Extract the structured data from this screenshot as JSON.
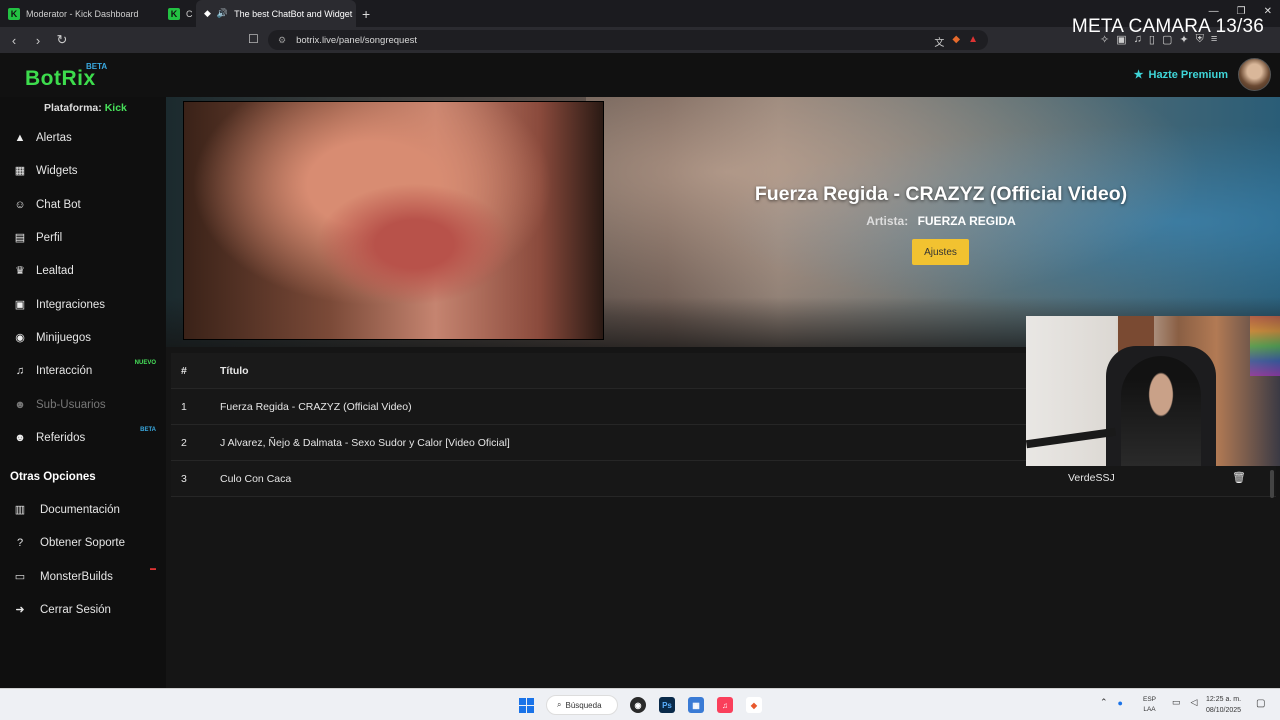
{
  "browser": {
    "tabs": [
      {
        "label": "Moderator - Kick Dashboard"
      },
      {
        "label": "C"
      },
      {
        "label": "The best ChatBot and Widget"
      }
    ],
    "url": "botrix.live/panel/songrequest",
    "overlay_text": "META CAMARA 13/36"
  },
  "header": {
    "logo": "BotRix",
    "logo_badge": "BETA",
    "premium_label": "Hazte Premium"
  },
  "sidebar": {
    "platform_label": "Plataforma:",
    "platform_value": "Kick",
    "items": [
      {
        "label": "Alertas",
        "icon": "warning-icon"
      },
      {
        "label": "Widgets",
        "icon": "grid-icon"
      },
      {
        "label": "Chat Bot",
        "icon": "robot-icon"
      },
      {
        "label": "Perfil",
        "icon": "id-card-icon"
      },
      {
        "label": "Lealtad",
        "icon": "trophy-icon"
      },
      {
        "label": "Integraciones",
        "icon": "cube-icon"
      },
      {
        "label": "Minijuegos",
        "icon": "gamepad-icon"
      },
      {
        "label": "Interacción",
        "icon": "music-icon",
        "badge": "NUEVO"
      },
      {
        "label": "Sub-Usuarios",
        "icon": "users-icon"
      },
      {
        "label": "Referidos",
        "icon": "users-icon",
        "badge": "BETA"
      }
    ],
    "section_title": "Otras Opciones",
    "options": [
      {
        "label": "Documentación",
        "icon": "book-icon"
      },
      {
        "label": "Obtener Soporte",
        "icon": "help-icon"
      },
      {
        "label": "MonsterBuilds",
        "icon": "laptop-icon"
      },
      {
        "label": "Cerrar Sesión",
        "icon": "logout-icon"
      }
    ]
  },
  "now_playing": {
    "title": "Fuerza Regida - CRAZYZ (Official Video)",
    "artist_label": "Artista:",
    "artist": "FUERZA REGIDA",
    "settings_button": "Ajustes"
  },
  "queue": {
    "headers": {
      "num": "#",
      "title": "Título"
    },
    "rows": [
      {
        "num": "1",
        "title": "Fuerza Regida - CRAZYZ (Official Video)",
        "user": ""
      },
      {
        "num": "2",
        "title": "J Alvarez, Ñejo & Dalmata - Sexo Sudor y Calor [Video Oficial]",
        "user": ""
      },
      {
        "num": "3",
        "title": "Culo Con Caca",
        "user": "VerdeSSJ"
      }
    ]
  },
  "taskbar": {
    "search_label": "Búsqueda",
    "lang_top": "ESP",
    "lang_bottom": "LAA",
    "time": "12:25 a. m.",
    "date": "08/10/2025"
  },
  "colors": {
    "brand_green": "#3ddc4d",
    "premium_cyan": "#3fd5d8",
    "button_yellow": "#f2c230"
  }
}
